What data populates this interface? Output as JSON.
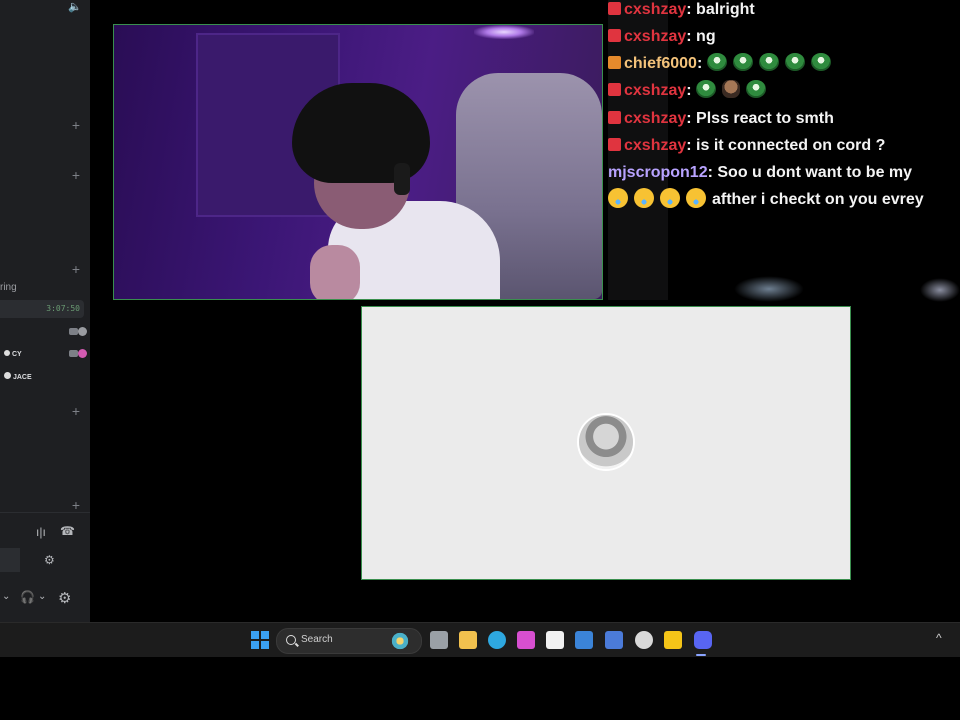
{
  "sidebar": {
    "label_partial": "ring",
    "timer": "3:07:50",
    "users": [
      {
        "name": "CY"
      },
      {
        "name": "JACE"
      }
    ],
    "icons": {
      "top": "speaker-icon",
      "plus": "plus-icon",
      "voice_settings": "soundboard-icon",
      "disconnect": "disconnect-icon",
      "activities": "activities-icon",
      "mic": "mic-chevron-icon",
      "headphones": "headphones-icon",
      "settings": "gear-icon"
    }
  },
  "chat": {
    "messages": [
      {
        "user": "cxshzay",
        "user_color": "#e0343f",
        "badge_color": "#e0343f",
        "text": "balright"
      },
      {
        "user": "cxshzay",
        "user_color": "#e0343f",
        "badge_color": "#e0343f",
        "text": "ng"
      },
      {
        "user": "chief6000",
        "user_color": "#f3c27a",
        "badge_color": "#e58a2c",
        "emotes": [
          "green",
          "green",
          "green",
          "green",
          "green"
        ]
      },
      {
        "user": "cxshzay",
        "user_color": "#e0343f",
        "badge_color": "#e0343f",
        "emotes": [
          "green",
          "rock",
          "green"
        ]
      },
      {
        "user": "cxshzay",
        "user_color": "#e0343f",
        "badge_color": "#e0343f",
        "text": "Plss react to smth"
      },
      {
        "user": "cxshzay",
        "user_color": "#e0343f",
        "badge_color": "#e0343f",
        "text": "is it connected on cord ?"
      },
      {
        "user": "mjscropon12",
        "user_color": "#b8a3ff",
        "badge_color": "",
        "text": "Soo u dont want to be my"
      },
      {
        "user": "",
        "user_color": "",
        "badge_color": "",
        "emojis": 4,
        "text": "afther i checkt on you evrey"
      }
    ]
  },
  "taskbar": {
    "search_placeholder": "Search",
    "apps": [
      {
        "name": "task-view-icon",
        "color": "#9aa0a6"
      },
      {
        "name": "file-explorer-icon",
        "color": "#f2c14e"
      },
      {
        "name": "edge-icon",
        "color": "#2ea8e0"
      },
      {
        "name": "copilot-icon",
        "color": "#d74fd0"
      },
      {
        "name": "store-icon",
        "color": "#f0f0f0"
      },
      {
        "name": "mail-icon",
        "color": "#3b84d8"
      },
      {
        "name": "roblox-studio-icon",
        "color": "#4b7bd9"
      },
      {
        "name": "chrome-icon",
        "color": "#d9d9d9"
      },
      {
        "name": "sticky-app-icon",
        "color": "#f5c518"
      },
      {
        "name": "discord-icon",
        "color": "#5865f2"
      }
    ],
    "tray_icon": "chevron-up-icon"
  }
}
